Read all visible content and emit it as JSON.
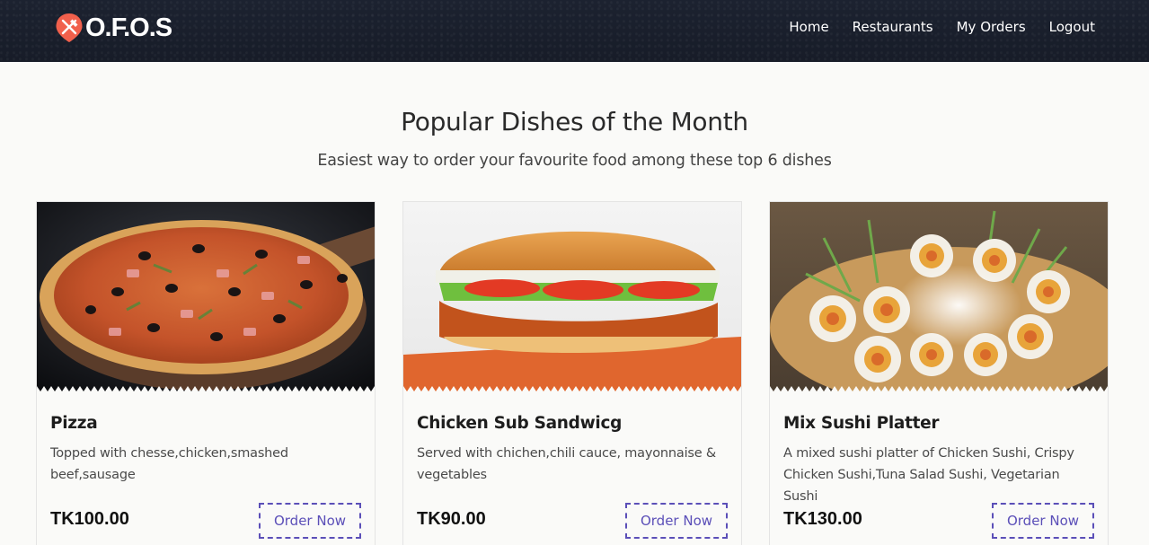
{
  "brand": {
    "name": "O.F.O.S",
    "accent": "#f1604c"
  },
  "nav": {
    "items": [
      "Home",
      "Restaurants",
      "My Orders",
      "Logout"
    ]
  },
  "hero": {
    "title": "Popular Dishes of the Month",
    "subtitle": "Easiest way to order your favourite food among these top 6 dishes"
  },
  "dishes": [
    {
      "name": "Pizza",
      "description": "Topped with chesse,chicken,smashed beef,sausage",
      "price": "TK100.00",
      "button": "Order Now"
    },
    {
      "name": "Chicken Sub Sandwicg",
      "description": "Served with chichen,chili cauce, mayonnaise & vegetables",
      "price": "TK90.00",
      "button": "Order Now"
    },
    {
      "name": "Mix Sushi Platter",
      "description": "A mixed sushi platter of Chicken Sushi, Crispy Chicken Sushi,Tuna Salad Sushi, Vegetarian Sushi",
      "price": "TK130.00",
      "button": "Order Now"
    }
  ],
  "colors": {
    "button": "#5b4fb8",
    "navbar": "#1a1f2b"
  }
}
